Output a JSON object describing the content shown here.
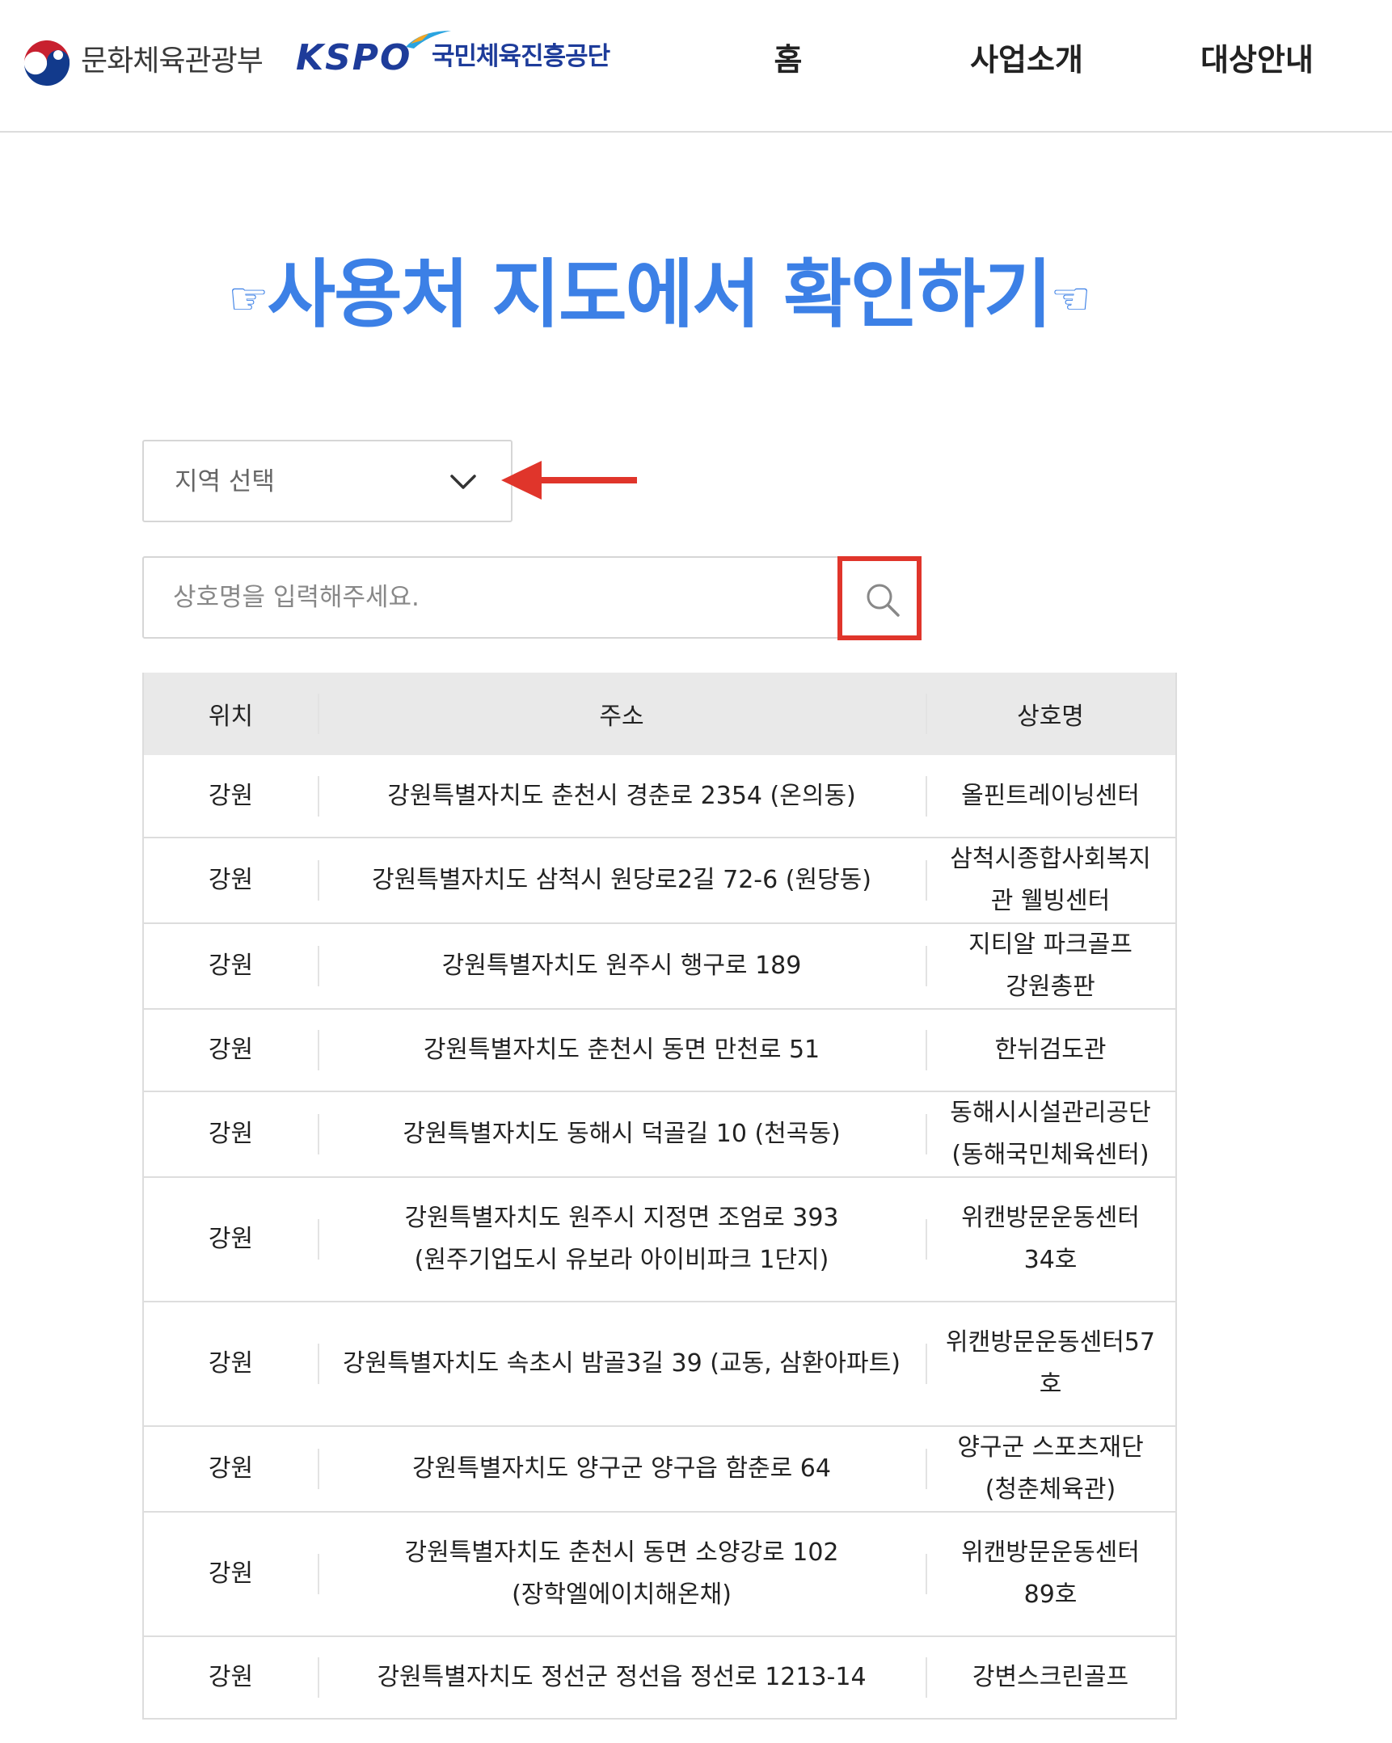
{
  "header": {
    "ministry_name": "문화체육관광부",
    "kspo_mark": "KSPO",
    "kspo_name": "국민체육진흥공단",
    "nav": [
      {
        "label": "홈"
      },
      {
        "label": "사업소개"
      },
      {
        "label": "대상안내"
      }
    ]
  },
  "title": {
    "left_hand": "☞",
    "text": "사용처 지도에서 확인하기",
    "right_hand": "☜"
  },
  "region_select": {
    "label": "지역 선택"
  },
  "search": {
    "placeholder": "상호명을 입력해주세요.",
    "icon": "search-icon"
  },
  "annotation": {
    "arrow_color": "#e0352b",
    "highlight_color": "#e0352b"
  },
  "colors": {
    "title": "#3c80e6",
    "kspo_brand": "#1e3c9a",
    "table_header_bg": "#e9e9e9"
  },
  "table": {
    "headers": [
      "위치",
      "주소",
      "상호명"
    ],
    "rows": [
      {
        "loc": "강원",
        "addr": "강원특별자치도 춘천시 경춘로 2354 (온의동)",
        "name": "올핀트레이닝센터"
      },
      {
        "loc": "강원",
        "addr": "강원특별자치도 삼척시 원당로2길 72-6 (원당동)",
        "name": "삼척시종합사회복지관 웰빙센터"
      },
      {
        "loc": "강원",
        "addr": "강원특별자치도 원주시 행구로 189",
        "name": "지티알 파크골프 강원총판"
      },
      {
        "loc": "강원",
        "addr": "강원특별자치도 춘천시 동면 만천로 51",
        "name": "한뉘검도관"
      },
      {
        "loc": "강원",
        "addr": "강원특별자치도 동해시 덕골길 10 (천곡동)",
        "name": "동해시시설관리공단 (동해국민체육센터)"
      },
      {
        "loc": "강원",
        "addr": "강원특별자치도 원주시 지정면 조엄로 393 (원주기업도시 유보라 아이비파크 1단지)",
        "name": "위캔방문운동센터 34호"
      },
      {
        "loc": "강원",
        "addr": "강원특별자치도 속초시 밤골3길 39 (교동, 삼환아파트)",
        "name": "위캔방문운동센터57호"
      },
      {
        "loc": "강원",
        "addr": "강원특별자치도 양구군 양구읍 함춘로 64",
        "name": "양구군 스포츠재단 (청춘체육관)"
      },
      {
        "loc": "강원",
        "addr": "강원특별자치도 춘천시 동면 소양강로 102 (장학엘에이치해온채)",
        "name": "위캔방문운동센터 89호"
      },
      {
        "loc": "강원",
        "addr": "강원특별자치도 정선군 정선읍 정선로 1213-14",
        "name": "강변스크린골프"
      }
    ]
  }
}
